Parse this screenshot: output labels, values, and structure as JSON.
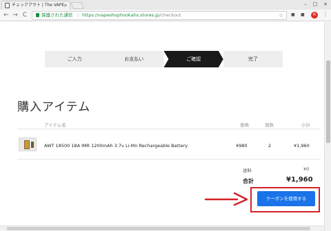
{
  "browser": {
    "tab_title": "チェックアウト | The VAPE",
    "tab_close": "×",
    "win_minimize": "–",
    "win_maximize": "□",
    "win_close": "×",
    "back_glyph": "←",
    "forward_glyph": "→",
    "reload_glyph": "C",
    "secure_label": "保護された通信",
    "url_host": "https://vapeshophookahs.stores.jp",
    "url_path": "/checkout",
    "star_glyph": "☆",
    "avatar_letter": "R",
    "menu_glyph": "⋮"
  },
  "steps": [
    {
      "label": "ご入力",
      "active": false
    },
    {
      "label": "お支払い",
      "active": false
    },
    {
      "label": "ご確認",
      "active": true
    },
    {
      "label": "完了",
      "active": false
    }
  ],
  "page": {
    "heading": "購入アイテム"
  },
  "table": {
    "headers": {
      "item": "アイテム名",
      "price": "価格",
      "qty": "個数",
      "subtotal": "小計"
    },
    "rows": [
      {
        "name": "AWT 18500 18A IMR 1200mAh 3.7v Li-Mn Rechargeable Battery",
        "price": "¥980",
        "qty": "2",
        "subtotal": "¥1,960"
      }
    ]
  },
  "summary": {
    "shipping_label": "送料",
    "shipping_value": "¥0",
    "total_label": "合計",
    "total_value": "¥1,960"
  },
  "coupon": {
    "button_label": "クーポンを使用する"
  },
  "colors": {
    "accent_blue": "#1a73e8",
    "annotation_red": "#d32027",
    "step_active": "#1a1a1a",
    "secure_green": "#1e8e3e"
  }
}
